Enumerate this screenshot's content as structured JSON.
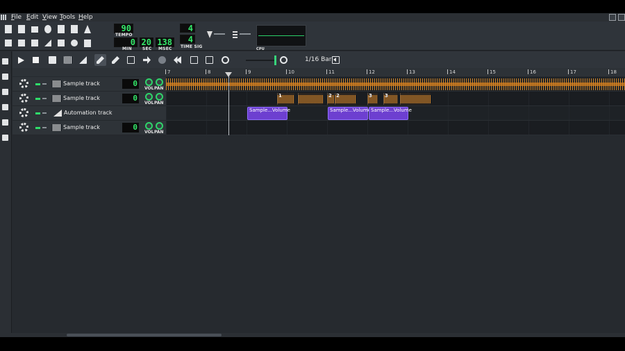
{
  "menubar": {
    "items": [
      "File",
      "Edit",
      "View",
      "Tools",
      "Help"
    ]
  },
  "toolbar": {
    "tempo_value": "90",
    "tempo_label": "TEMPO",
    "time_min": "0",
    "time_sec": "20",
    "time_msec": "138",
    "min_label": "MIN",
    "sec_label": "SEC",
    "msec_label": "MSEC",
    "timesig_num": "4",
    "timesig_den": "4",
    "timesig_label": "TIME SIG",
    "cpu_label": "CPU"
  },
  "song_toolbar": {
    "quantize": "1/16 Bar"
  },
  "ruler": {
    "bars": [
      "7",
      "8",
      "9",
      "10",
      "11",
      "12",
      "13",
      "14",
      "15",
      "16",
      "17",
      "18"
    ]
  },
  "tracks": [
    {
      "name": "Sample track",
      "type": "sample",
      "volume": "0",
      "vol_label": "VOL",
      "pan_label": "PAN"
    },
    {
      "name": "Sample track",
      "type": "sample",
      "volume": "0",
      "vol_label": "VOL",
      "pan_label": "PAN"
    },
    {
      "name": "Automation track",
      "type": "automation"
    },
    {
      "name": "Sample track",
      "type": "sample",
      "volume": "0",
      "vol_label": "VOL",
      "pan_label": "PAN"
    }
  ],
  "sample_clips": [
    "1",
    "",
    "2",
    "2",
    "3",
    "3",
    ""
  ],
  "automation_clips": [
    "Sample...Volume",
    "Sample...Volume",
    "Sample...Volume"
  ],
  "colors": {
    "lcd_green": "#34e86a",
    "waveform_orange": "#d98a2a",
    "automation_purple": "#6d3fd0",
    "background": "#262a2f"
  }
}
